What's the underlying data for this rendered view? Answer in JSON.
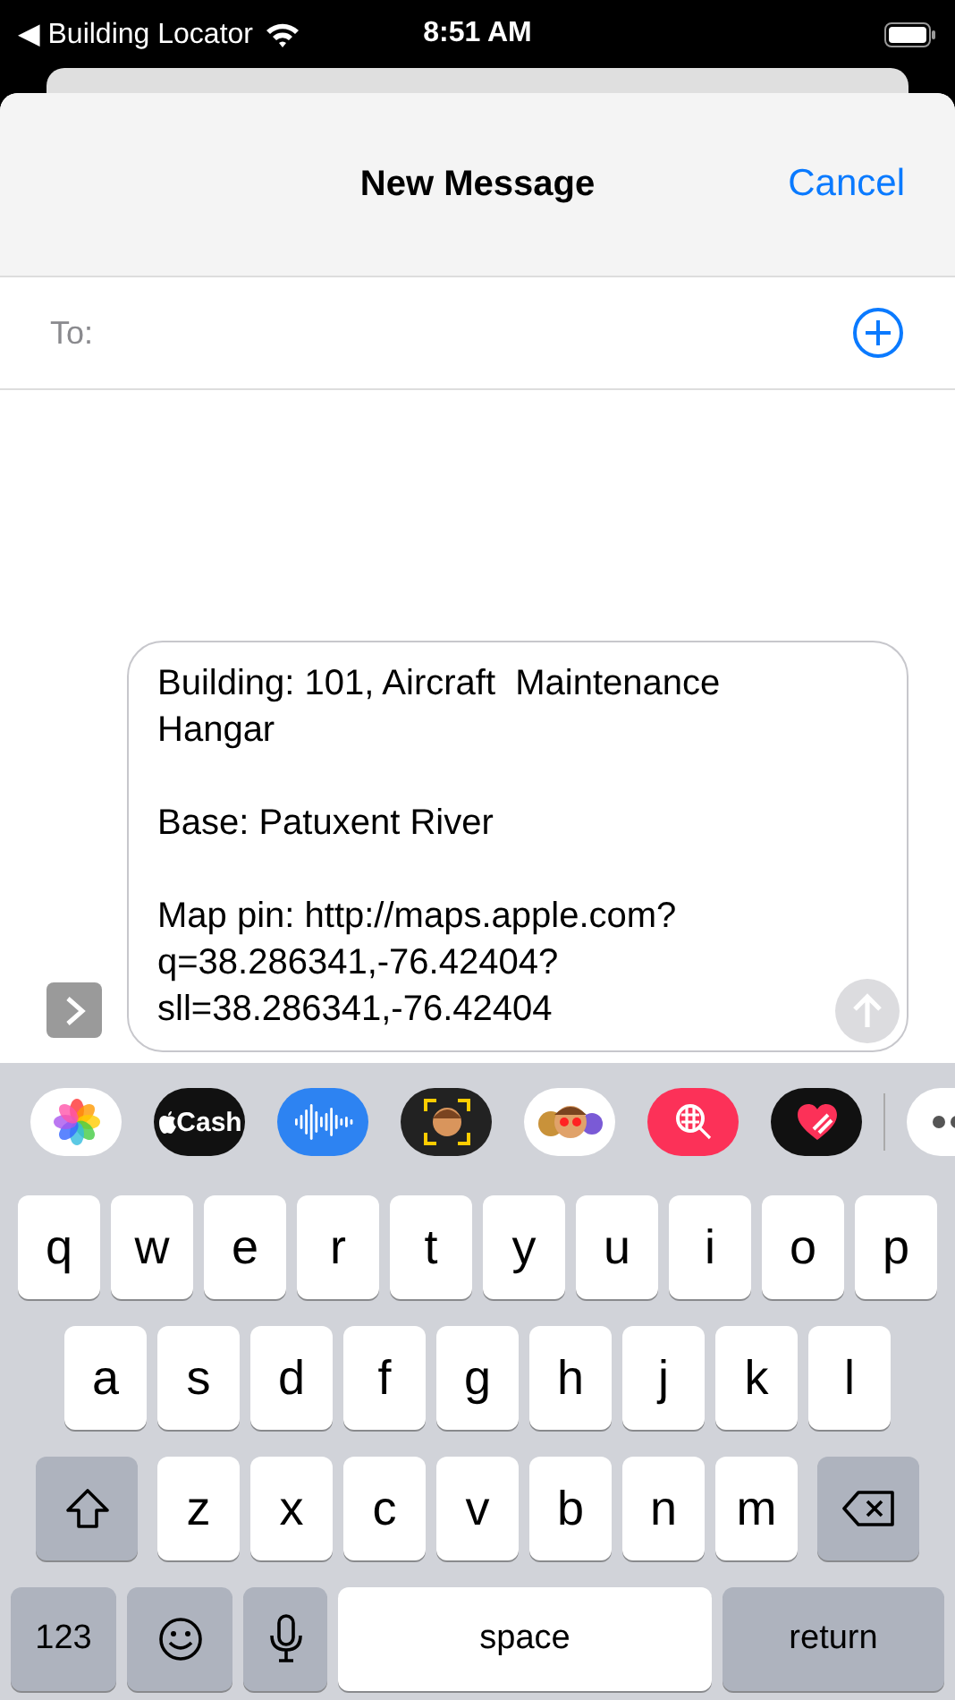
{
  "status_bar": {
    "back_label": "◀ Building Locator",
    "time": "8:51 AM"
  },
  "header": {
    "title": "New Message",
    "cancel": "Cancel"
  },
  "to_field": {
    "label": "To:"
  },
  "message": {
    "paragraphs": [
      [
        "Building: 101, Aircraft  Maintenance",
        "Hangar"
      ],
      [
        "Base: Patuxent River"
      ],
      [
        "Map pin: http://maps.apple.com?",
        "q=38.286341,-76.42404?",
        "sll=38.286341,-76.42404"
      ]
    ],
    "send_disabled": true
  },
  "apps": [
    {
      "kind": "photos"
    },
    {
      "kind": "cash",
      "label": "Cash"
    },
    {
      "kind": "audio"
    },
    {
      "kind": "memoji"
    },
    {
      "kind": "stickers"
    },
    {
      "kind": "search"
    },
    {
      "kind": "heart"
    },
    {
      "kind": "more"
    }
  ],
  "keyboard": {
    "letter_rows": [
      [
        {
          "kind": "letter",
          "label": "q"
        },
        {
          "kind": "letter",
          "label": "w"
        },
        {
          "kind": "letter",
          "label": "e"
        },
        {
          "kind": "letter",
          "label": "r"
        },
        {
          "kind": "letter",
          "label": "t"
        },
        {
          "kind": "letter",
          "label": "y"
        },
        {
          "kind": "letter",
          "label": "u"
        },
        {
          "kind": "letter",
          "label": "i"
        },
        {
          "kind": "letter",
          "label": "o"
        },
        {
          "kind": "letter",
          "label": "p"
        }
      ],
      [
        {
          "kind": "letter",
          "label": "a"
        },
        {
          "kind": "letter",
          "label": "s"
        },
        {
          "kind": "letter",
          "label": "d"
        },
        {
          "kind": "letter",
          "label": "f"
        },
        {
          "kind": "letter",
          "label": "g"
        },
        {
          "kind": "letter",
          "label": "h"
        },
        {
          "kind": "letter",
          "label": "j"
        },
        {
          "kind": "letter",
          "label": "k"
        },
        {
          "kind": "letter",
          "label": "l"
        }
      ],
      [
        {
          "kind": "shift"
        },
        {
          "kind": "letter",
          "label": "z"
        },
        {
          "kind": "letter",
          "label": "x"
        },
        {
          "kind": "letter",
          "label": "c"
        },
        {
          "kind": "letter",
          "label": "v"
        },
        {
          "kind": "letter",
          "label": "b"
        },
        {
          "kind": "letter",
          "label": "n"
        },
        {
          "kind": "letter",
          "label": "m"
        },
        {
          "kind": "delete"
        }
      ]
    ],
    "bottom_bar": [
      {
        "kind": "numbers",
        "label": "123"
      },
      {
        "kind": "emoji"
      },
      {
        "kind": "mic"
      },
      {
        "kind": "space",
        "label": "space"
      },
      {
        "kind": "return",
        "label": "return"
      }
    ]
  }
}
